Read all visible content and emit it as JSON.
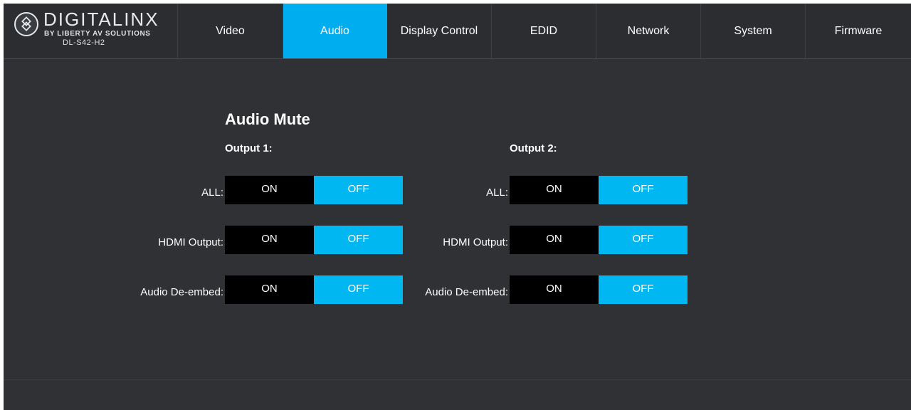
{
  "brand": {
    "name": "DIGITALINX",
    "tagline": "BY LIBERTY AV SOLUTIONS",
    "model": "DL-S42-H2",
    "icon": "diamond-logo-icon"
  },
  "nav": {
    "tabs": [
      {
        "label": "Video"
      },
      {
        "label": "Audio",
        "active": true
      },
      {
        "label": "Display Control"
      },
      {
        "label": "EDID"
      },
      {
        "label": "Network"
      },
      {
        "label": "System"
      },
      {
        "label": "Firmware"
      }
    ]
  },
  "colors": {
    "accent": "#00aeef",
    "background": "#2f3134",
    "on_button": "#000000",
    "off_button": "#00b7f1"
  },
  "audio_mute": {
    "title": "Audio Mute",
    "outputs": [
      {
        "title": "Output 1:",
        "rows": [
          {
            "label": "ALL:",
            "on": "ON",
            "off": "OFF",
            "selected": "OFF"
          },
          {
            "label": "HDMI Output:",
            "on": "ON",
            "off": "OFF",
            "selected": "OFF"
          },
          {
            "label": "Audio De-embed:",
            "on": "ON",
            "off": "OFF",
            "selected": "OFF"
          }
        ]
      },
      {
        "title": "Output 2:",
        "rows": [
          {
            "label": "ALL:",
            "on": "ON",
            "off": "OFF",
            "selected": "OFF"
          },
          {
            "label": "HDMI Output:",
            "on": "ON",
            "off": "OFF",
            "selected": "OFF"
          },
          {
            "label": "Audio De-embed:",
            "on": "ON",
            "off": "OFF",
            "selected": "OFF"
          }
        ]
      }
    ]
  }
}
